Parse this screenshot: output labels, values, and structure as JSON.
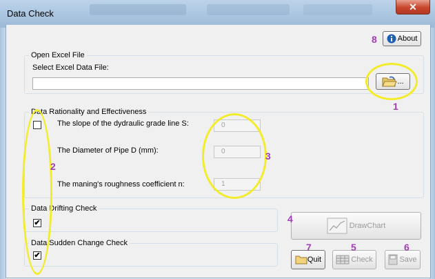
{
  "window": {
    "title": "Data Check",
    "close_glyph": "✕"
  },
  "about_button": {
    "label": "About",
    "icon": "info-icon"
  },
  "open_excel": {
    "legend": "Open Excel File",
    "select_label": "Select Excel Data File:",
    "file_path": "",
    "browse_label": "..."
  },
  "rationality": {
    "legend": "Data Rationality and Effectiveness",
    "checked": false,
    "fields": [
      {
        "label": "The slope of the dydraulic grade line S:",
        "value": "0"
      },
      {
        "label": "The Diameter of Pipe D (mm):",
        "value": "0"
      },
      {
        "label": "The maning's roughness coefficient n:",
        "value": "1"
      }
    ]
  },
  "drifting": {
    "legend": "Data Drifting Check",
    "checked": true,
    "mark": "✔"
  },
  "sudden": {
    "legend": "Data Sudden Change Check",
    "checked": true,
    "mark": "✔"
  },
  "buttons": {
    "drawchart": "DrawChart",
    "quit": "Quit",
    "check": "Check",
    "save": "Save"
  },
  "annotations": [
    "1",
    "2",
    "3",
    "4",
    "5",
    "6",
    "7",
    "8"
  ],
  "colors": {
    "annotation_circle": "#f2ec2c",
    "annotation_number": "#a23bb6"
  }
}
